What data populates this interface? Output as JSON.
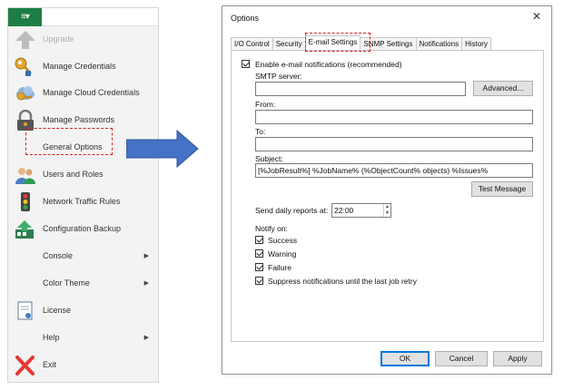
{
  "menu": {
    "button_glyph": "≡▾",
    "items": [
      {
        "label": "Upgrade",
        "icon": "upgrade-arrow-icon",
        "disabled": true
      },
      {
        "label": "Manage Credentials",
        "icon": "key-icon"
      },
      {
        "label": "Manage Cloud Credentials",
        "icon": "cloud-key-icon"
      },
      {
        "label": "Manage Passwords",
        "icon": "lock-icon"
      },
      {
        "label": "General Options",
        "icon": "none"
      },
      {
        "label": "Users and Roles",
        "icon": "users-icon"
      },
      {
        "label": "Network Traffic Rules",
        "icon": "traffic-light-icon"
      },
      {
        "label": "Configuration Backup",
        "icon": "config-backup-icon"
      },
      {
        "label": "Console",
        "icon": "none",
        "submenu": true
      },
      {
        "label": "Color Theme",
        "icon": "none",
        "submenu": true
      },
      {
        "label": "License",
        "icon": "license-icon"
      },
      {
        "label": "Help",
        "icon": "none",
        "submenu": true
      },
      {
        "label": "Exit",
        "icon": "exit-x-icon"
      }
    ],
    "submenu_glyph": "▶"
  },
  "dialog": {
    "title": "Options",
    "close_glyph": "✕",
    "tabs": [
      "I/O Control",
      "Security",
      "E-mail Settings",
      "SNMP Settings",
      "Notifications",
      "History"
    ],
    "active_tab": "E-mail Settings",
    "enable_label": "Enable e-mail notifications (recommended)",
    "smtp_label": "SMTP server:",
    "smtp_value": "",
    "advanced_label": "Advanced...",
    "from_label": "From:",
    "from_value": "",
    "to_label": "To:",
    "to_value": "",
    "subject_label": "Subject:",
    "subject_value": "[%JobResult%] %JobName% (%ObjectCount% objects) %Issues%",
    "test_label": "Test Message",
    "daily_label": "Send daily reports at:",
    "daily_value": "22:00",
    "notify_label": "Notify on:",
    "notify": [
      {
        "label": "Success",
        "checked": true
      },
      {
        "label": "Warning",
        "checked": true
      },
      {
        "label": "Failure",
        "checked": true
      },
      {
        "label": "Suppress notifications until the last job retry",
        "checked": true
      }
    ],
    "ok_label": "OK",
    "cancel_label": "Cancel",
    "apply_label": "Apply"
  },
  "colors": {
    "accent_green": "#1d7e45",
    "arrow_blue": "#3f6fc6",
    "highlight_red": "#d32020"
  }
}
